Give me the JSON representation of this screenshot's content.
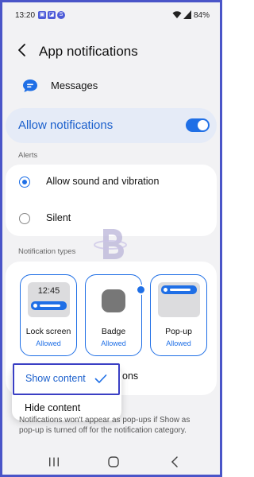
{
  "status_bar": {
    "time": "13:20",
    "battery": "84%",
    "notification_icons": [
      "gallery-icon",
      "photo-icon",
      "samsung-icon"
    ]
  },
  "header": {
    "title": "App notifications"
  },
  "app": {
    "name": "Messages",
    "icon": "messages-icon"
  },
  "allow_notifications": {
    "label": "Allow notifications",
    "enabled": true
  },
  "alerts": {
    "section_label": "Alerts",
    "options": [
      {
        "label": "Allow sound and vibration",
        "selected": true
      },
      {
        "label": "Silent",
        "selected": false
      }
    ]
  },
  "notification_types": {
    "section_label": "Notification types",
    "tiles": [
      {
        "title": "Lock screen",
        "status": "Allowed",
        "preview_time": "12:45"
      },
      {
        "title": "Badge",
        "status": "Allowed"
      },
      {
        "title": "Pop-up",
        "status": "Allowed"
      }
    ],
    "content_row_visible_suffix": "ons"
  },
  "dropdown": {
    "options": [
      {
        "label": "Show content",
        "selected": true
      },
      {
        "label": "Hide content",
        "selected": false
      }
    ]
  },
  "footnote": "Notifications won't appear as pop-ups if Show as pop-up is turned off for the notification category.",
  "colors": {
    "accent": "#1f6fe6",
    "highlight_border": "#3a3fc4",
    "allow_card_bg": "#e5ebf7",
    "screen_bg": "#f2f2f4"
  }
}
